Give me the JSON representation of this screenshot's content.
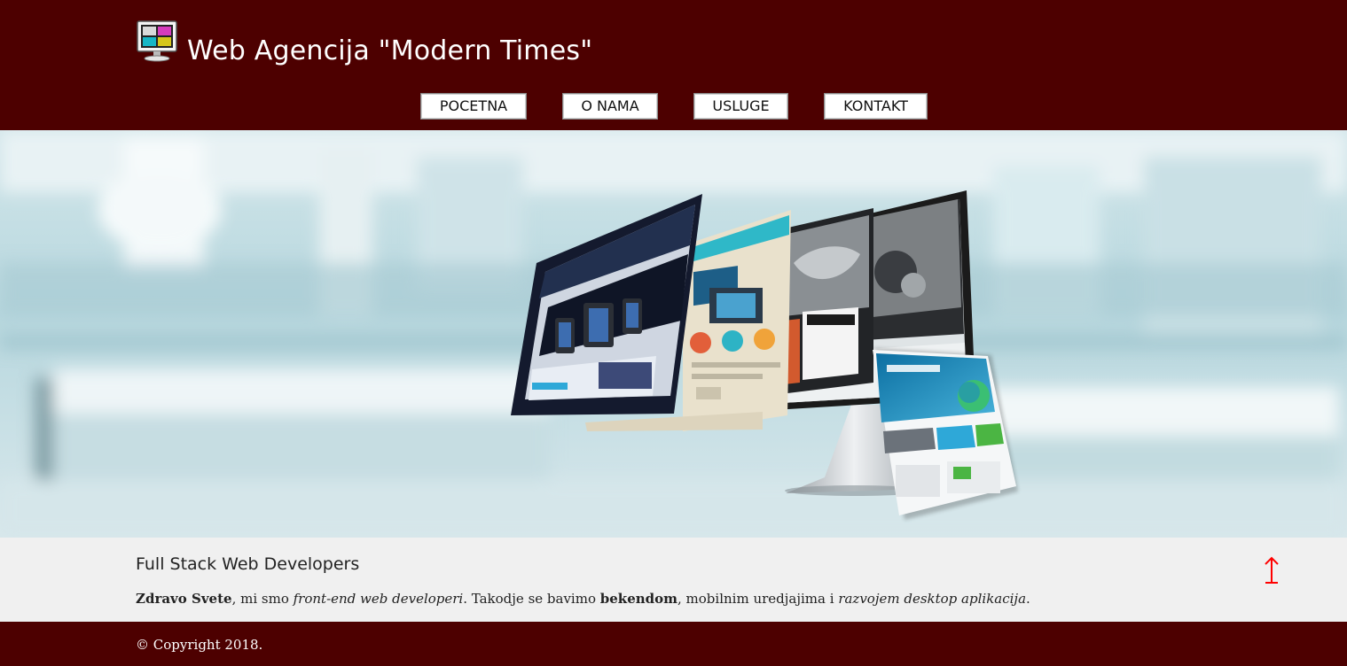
{
  "header": {
    "logo_icon": "monitor-icon",
    "title": "Web Agencija \"Modern Times\""
  },
  "nav": {
    "items": [
      {
        "label": "POCETNA"
      },
      {
        "label": "O NAMA"
      },
      {
        "label": "USLUGE"
      },
      {
        "label": "KONTAKT"
      }
    ]
  },
  "hero": {
    "image": "devices-showcase-image"
  },
  "content": {
    "title": "Full Stack Web Developers",
    "paragraph": {
      "greeting": "Zdravo Svete",
      "t1": ", mi smo ",
      "i1": "front-end web developeri",
      "t2": ". Takodje se bavimo ",
      "b1": "bekendom",
      "t3": ", mobilnim uredjajima i ",
      "i2": "razvojem desktop aplikacija",
      "t4": "."
    },
    "scroll_top_icon": "up-arrow-icon"
  },
  "footer": {
    "copyright": "© Copyright 2018."
  },
  "colors": {
    "brand": "#4d0000",
    "content_bg": "#f0f0f0",
    "arrow": "#ff0000"
  }
}
